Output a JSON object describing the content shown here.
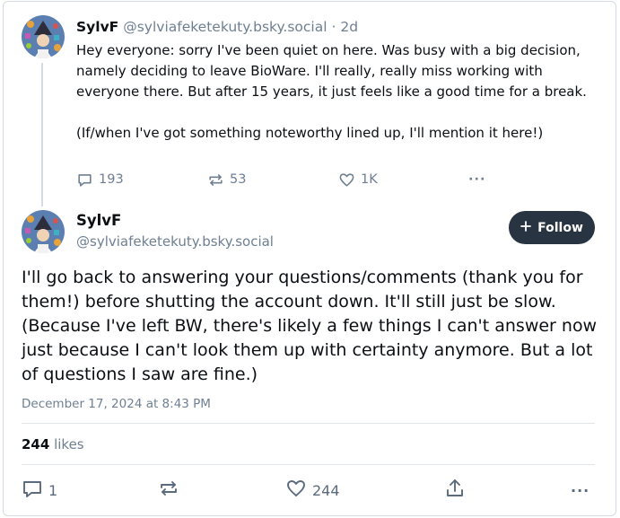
{
  "parent_post": {
    "author_name": "SylvF",
    "author_handle": "@sylviafeketekuty.bsky.social",
    "separator": "·",
    "time_ago": "2d",
    "text": "Hey everyone: sorry I've been quiet on here. Was busy with a big decision, namely deciding to leave BioWare. I'll really, really miss working with everyone there. But after 15 years, it just feels like a good time for a break.\n\n(If/when I've got something noteworthy lined up, I'll mention it here!)",
    "reply_count": "193",
    "repost_count": "53",
    "like_count": "1K",
    "more_label": "···"
  },
  "main_post": {
    "author_name": "SylvF",
    "author_handle": "@sylviafeketekuty.bsky.social",
    "follow_label": "Follow",
    "text": "I'll go back to answering your questions/comments (thank you for them!) before shutting the account down. It'll still just be slow. (Because I've left BW, there's likely a few things I can't answer now just because I can't look them up with certainty anymore. But a lot of questions I saw are fine.)",
    "date": "December 17, 2024 at 8:43 PM",
    "likes_count": "244",
    "likes_label": "likes",
    "reply_count": "1",
    "like_count": "244",
    "more_label": "···"
  },
  "icons": {
    "reply": "speech-bubble-icon",
    "repost": "repost-arrows-icon",
    "like": "heart-icon",
    "share": "share-icon",
    "more": "more-dots-icon",
    "follow": "plus-icon"
  },
  "colors": {
    "text": "#0b0f14",
    "muted": "#6f7f92",
    "follow_button_bg": "#283441",
    "divider": "#e0e5ea"
  }
}
